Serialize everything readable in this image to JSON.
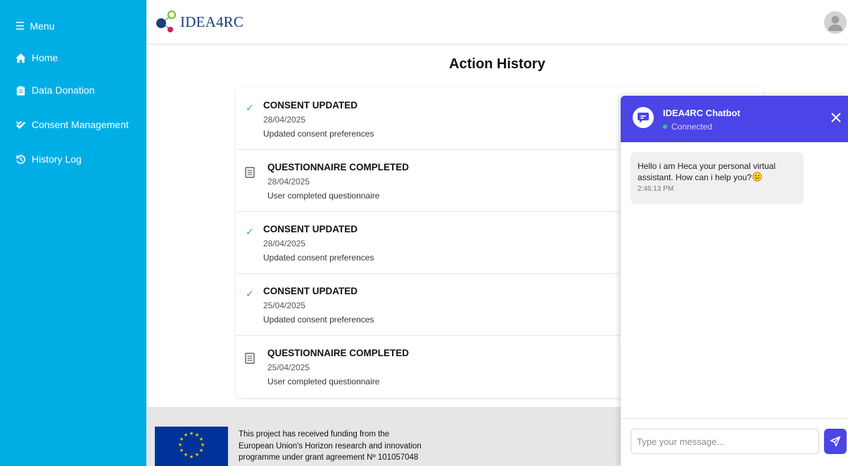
{
  "sidebar": {
    "menu_label": "Menu",
    "items": [
      {
        "label": "Home",
        "icon": "home-icon"
      },
      {
        "label": "Data Donation",
        "icon": "clipboard-icon"
      },
      {
        "label": "Consent Management",
        "icon": "double-check-icon"
      },
      {
        "label": "History Log",
        "icon": "history-icon"
      }
    ],
    "color": "#00aee6"
  },
  "header": {
    "logo_text": "IDEA4RC",
    "avatar_icon": "user-avatar-icon"
  },
  "main": {
    "title": "Action History",
    "history": [
      {
        "type": "consent",
        "icon": "check-icon",
        "title": "CONSENT UPDATED",
        "date": "28/04/2025",
        "description": "Updated consent preferences"
      },
      {
        "type": "questionnaire",
        "icon": "document-icon",
        "title": "QUESTIONNAIRE COMPLETED",
        "date": "28/04/2025",
        "description": "User completed questionnaire"
      },
      {
        "type": "consent",
        "icon": "check-icon",
        "title": "CONSENT UPDATED",
        "date": "28/04/2025",
        "description": "Updated consent preferences"
      },
      {
        "type": "consent",
        "icon": "check-icon",
        "title": "CONSENT UPDATED",
        "date": "25/04/2025",
        "description": "Updated consent preferences"
      },
      {
        "type": "questionnaire",
        "icon": "document-icon",
        "title": "QUESTIONNAIRE COMPLETED",
        "date": "25/04/2025",
        "description": "User completed questionnaire"
      }
    ]
  },
  "footer": {
    "text_lines": [
      "This project has received funding from the",
      "European Union's Horizon research and innovation",
      "programme under grant agreement Nº 101057048"
    ],
    "flag_icon": "eu-flag-icon"
  },
  "chatbot": {
    "title": "IDEA4RC Chatbot",
    "status": "Connected",
    "messages": [
      {
        "text": "Hello i am Heca your personal virtual assistant. How can i help you?",
        "emoji": "smiley-icon",
        "time": "2:46:13 PM"
      }
    ],
    "input_placeholder": "Type your message...",
    "accent": "#4b44e6"
  }
}
